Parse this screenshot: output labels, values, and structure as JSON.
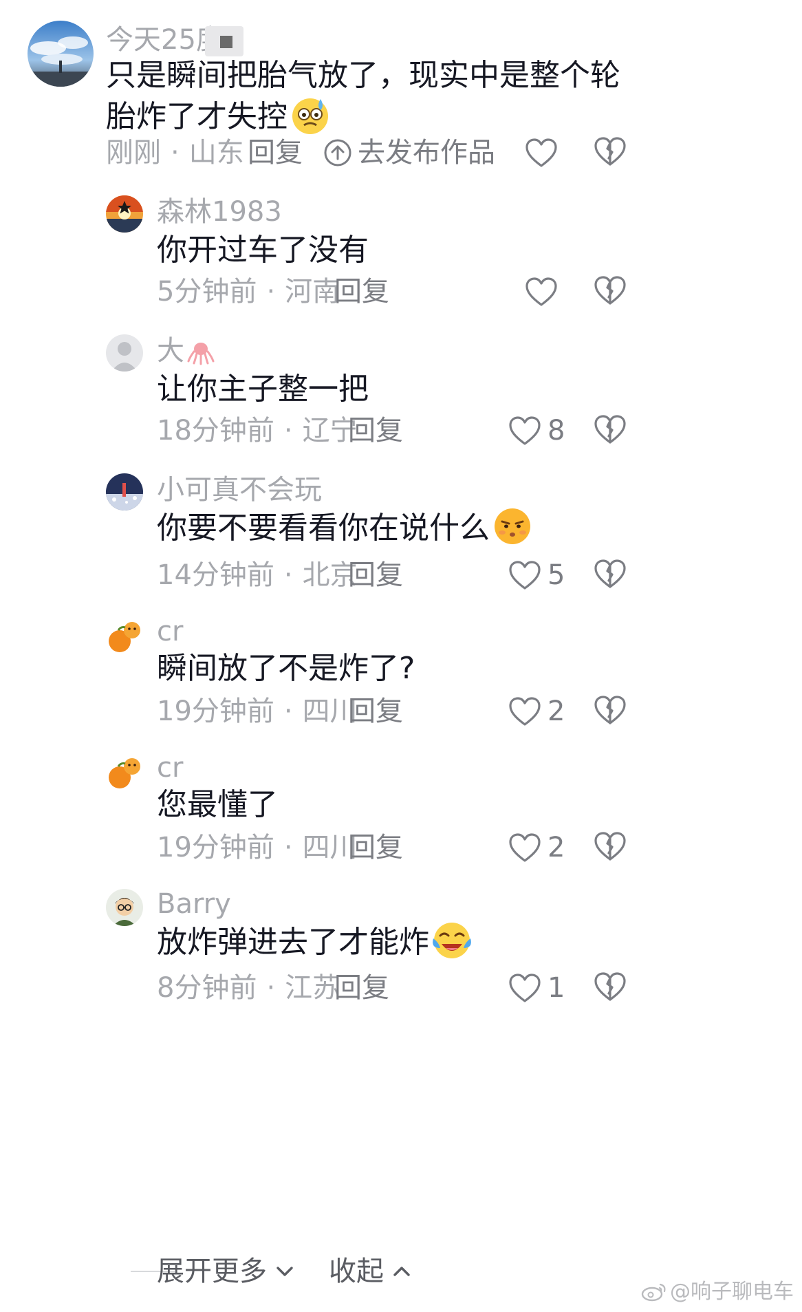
{
  "main_comment": {
    "username": "今天25度",
    "content": "只是瞬间把胎气放了，现实中是整个轮胎炸了才失控",
    "emoji": "sweat-emoji",
    "time": "刚刚",
    "location": "山东",
    "reply_label": "回复",
    "publish_label": "去发布作品"
  },
  "replies": [
    {
      "username": "森林1983",
      "content": "你开过车了没有",
      "time": "5分钟前",
      "location": "河南",
      "reply_label": "回复",
      "likes": ""
    },
    {
      "username": "大",
      "content": "让你主子整一把",
      "time": "18分钟前",
      "location": "辽宁",
      "reply_label": "回复",
      "likes": "8"
    },
    {
      "username": "小可真不会玩",
      "content": "你要不要看看你在说什么",
      "emoji": "annoyed-emoji",
      "time": "14分钟前",
      "location": "北京",
      "reply_label": "回复",
      "likes": "5"
    },
    {
      "username": "cr",
      "content": "瞬间放了不是炸了?",
      "time": "19分钟前",
      "location": "四川",
      "reply_label": "回复",
      "likes": "2"
    },
    {
      "username": "cr",
      "content": "您最懂了",
      "time": "19分钟前",
      "location": "四川",
      "reply_label": "回复",
      "likes": "2"
    },
    {
      "username": "Barry",
      "content": "放炸弹进去了才能炸",
      "emoji": "laugh-cry-emoji",
      "time": "8分钟前",
      "location": "江苏",
      "reply_label": "回复",
      "likes": "1"
    }
  ],
  "footer": {
    "expand_label": "展开更多",
    "collapse_label": "收起"
  },
  "watermark": "@响子聊电车",
  "colors": {
    "text": "#161823",
    "meta": "#a6a8ad",
    "action": "#7b7d83"
  }
}
